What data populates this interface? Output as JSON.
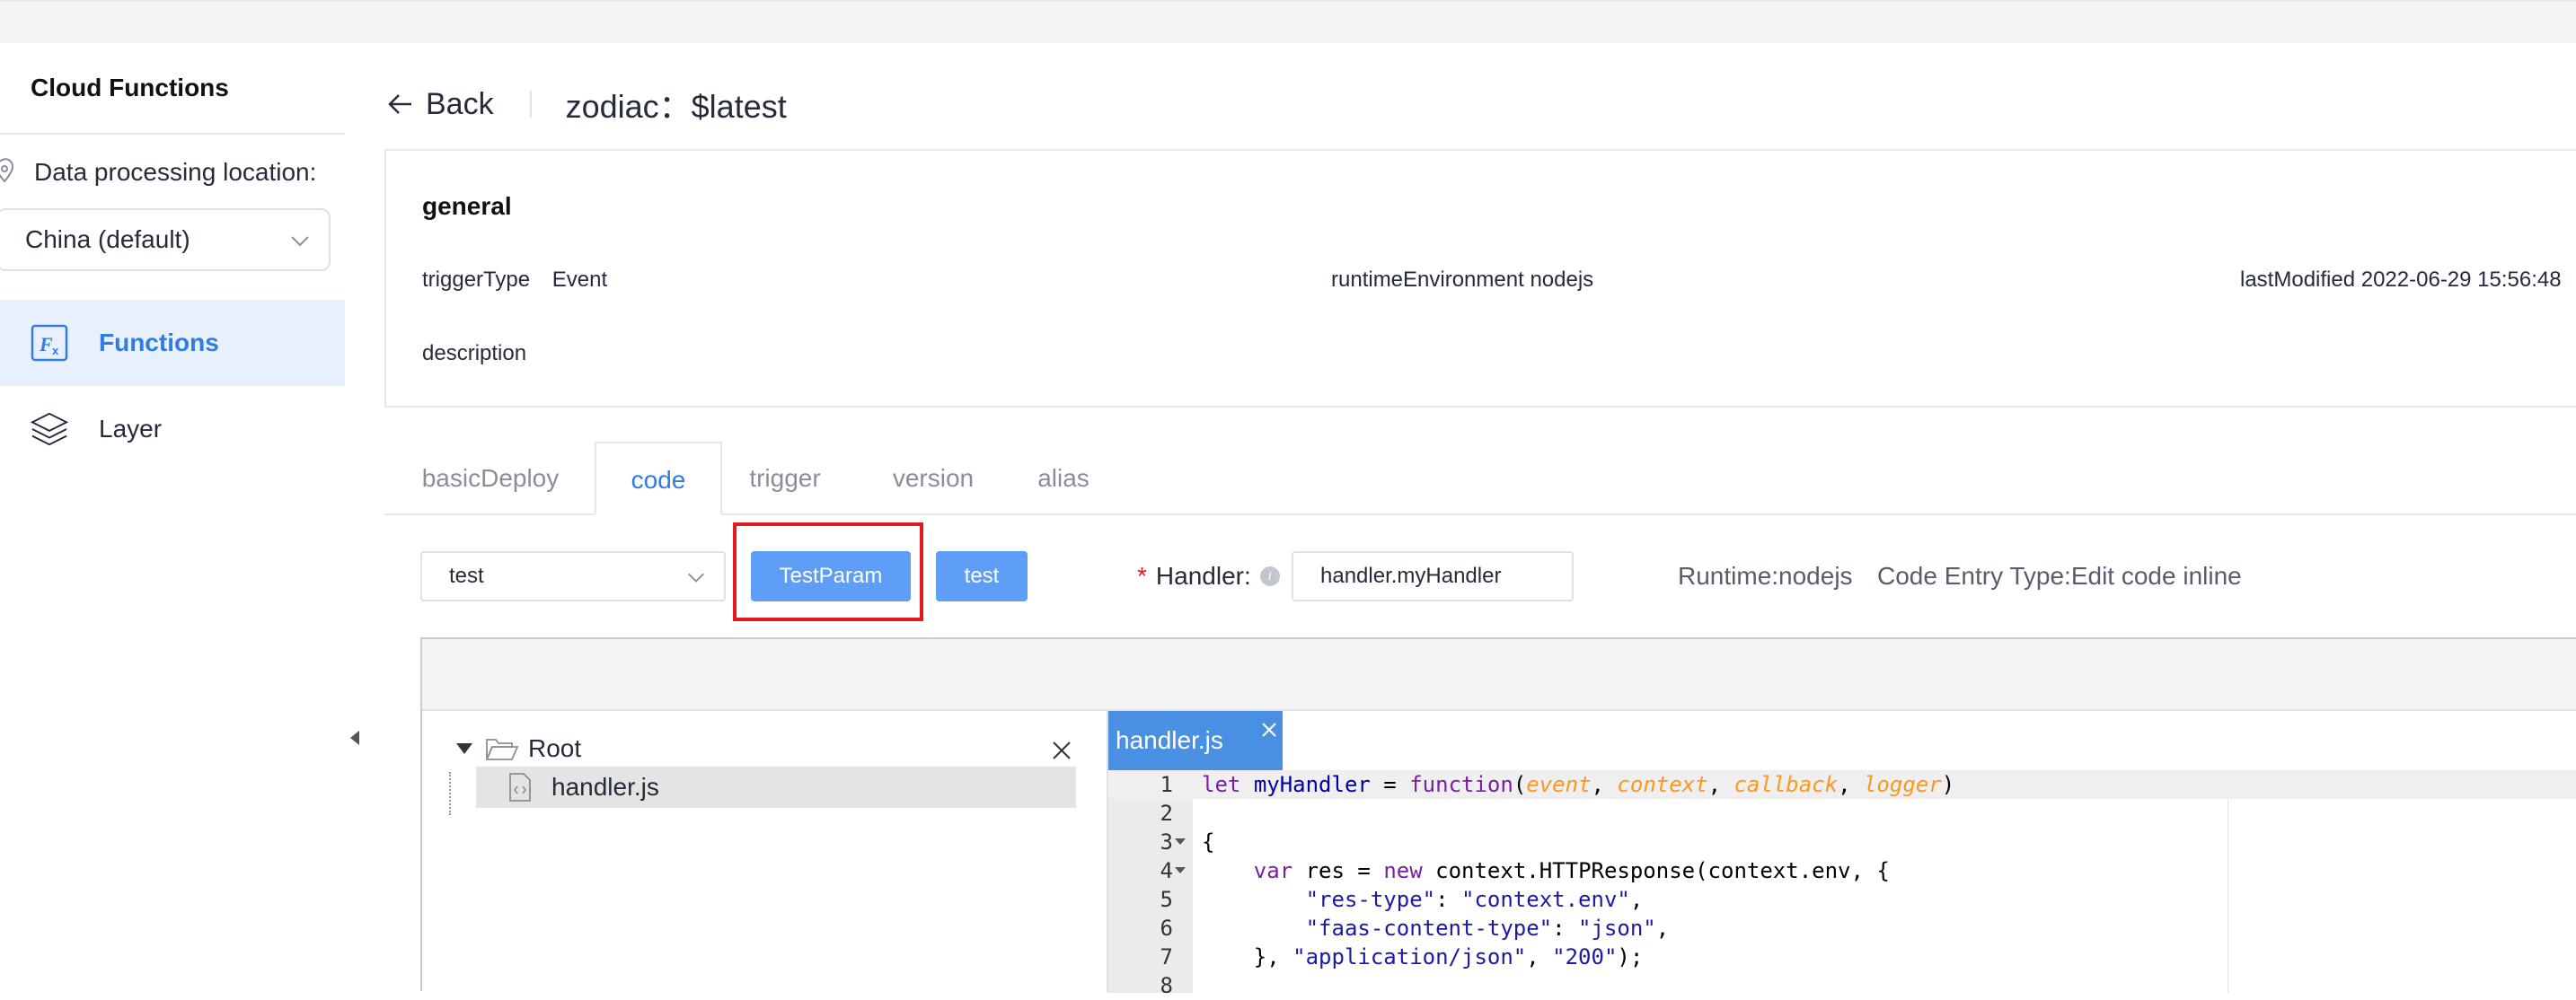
{
  "sidebar": {
    "title": "Cloud Functions",
    "location_label": "Data processing location:",
    "region_value": "China  (default)",
    "nav": [
      {
        "label": "Functions",
        "icon": "function-icon",
        "active": true
      },
      {
        "label": "Layer",
        "icon": "layers-icon",
        "active": false
      }
    ]
  },
  "header": {
    "back_label": "Back",
    "title": "zodiac：$latest"
  },
  "general": {
    "title": "general",
    "trigger_type_key": "triggerType",
    "trigger_type_value": "Event",
    "runtime_key": "runtimeEnvironment",
    "runtime_value": "nodejs",
    "last_modified_key": "lastModified",
    "last_modified_value": "2022-06-29 15:56:48",
    "description_key": "description"
  },
  "tabs": [
    {
      "label": "basicDeploy",
      "active": false
    },
    {
      "label": "code",
      "active": true
    },
    {
      "label": "trigger",
      "active": false
    },
    {
      "label": "version",
      "active": false
    },
    {
      "label": "alias",
      "active": false
    }
  ],
  "toolbar": {
    "test_select_value": "test",
    "test_param_button": "TestParam",
    "test_button": "test",
    "handler_required_mark": "*",
    "handler_label": "Handler:",
    "handler_value": "handler.myHandler",
    "runtime_text": "Runtime:nodejs",
    "entry_type_text": "Code Entry Type:Edit code inline"
  },
  "file_tree": {
    "root_label": "Root",
    "files": [
      "handler.js"
    ]
  },
  "editor": {
    "open_tab": "handler.js",
    "line_numbers": [
      "1",
      "2",
      "3",
      "4",
      "5",
      "6",
      "7",
      "8"
    ]
  },
  "colors": {
    "accent": "#2f7de1",
    "button": "#5e9ef7",
    "highlight": "#e21c1c",
    "file_tab": "#4a90e2"
  }
}
